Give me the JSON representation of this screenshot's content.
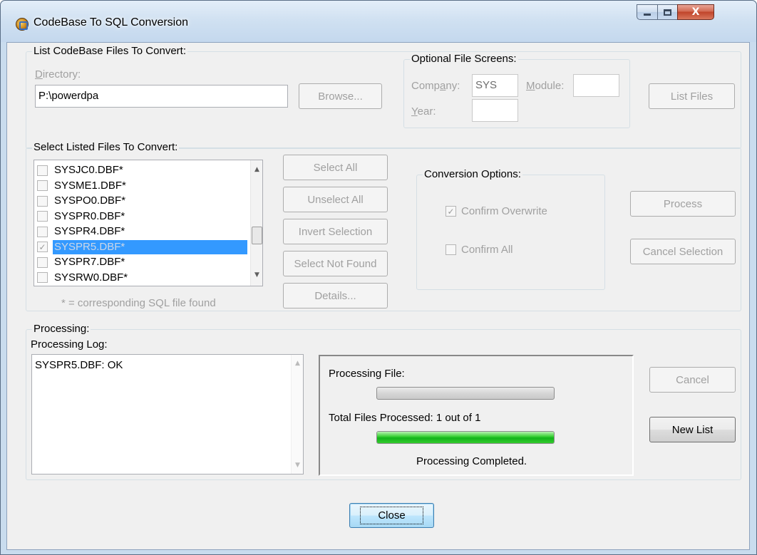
{
  "window": {
    "title": "CodeBase To SQL Conversion",
    "close_glyph": "X"
  },
  "list_group": {
    "label": "List CodeBase Files To Convert:",
    "directory_label": "Directory:",
    "directory_value": "P:\\powerdpa",
    "browse_button": "Browse...",
    "list_files_button": "List Files"
  },
  "screens_group": {
    "label": "Optional File Screens:",
    "company_label": "Company:",
    "company_value": "SYS",
    "module_label": "Module:",
    "module_value": "",
    "year_label": "Year:",
    "year_value": ""
  },
  "select_group": {
    "label": "Select Listed Files To Convert:",
    "files": [
      {
        "name": "SYSJC0.DBF*",
        "checked": false,
        "selected": false
      },
      {
        "name": "SYSME1.DBF*",
        "checked": false,
        "selected": false
      },
      {
        "name": "SYSPO0.DBF*",
        "checked": false,
        "selected": false
      },
      {
        "name": "SYSPR0.DBF*",
        "checked": false,
        "selected": false
      },
      {
        "name": "SYSPR4.DBF*",
        "checked": false,
        "selected": false
      },
      {
        "name": "SYSPR5.DBF*",
        "checked": true,
        "selected": true
      },
      {
        "name": "SYSPR7.DBF*",
        "checked": false,
        "selected": false
      },
      {
        "name": "SYSRW0.DBF*",
        "checked": false,
        "selected": false
      }
    ],
    "footnote": "* = corresponding SQL file found",
    "select_all": "Select All",
    "unselect_all": "Unselect All",
    "invert_selection": "Invert Selection",
    "select_not_found": "Select Not Found",
    "details": "Details...",
    "process": "Process",
    "cancel_selection": "Cancel Selection"
  },
  "conversion_options": {
    "label": "Conversion Options:",
    "confirm_overwrite": "Confirm Overwrite",
    "confirm_overwrite_checked": true,
    "confirm_all": "Confirm All",
    "confirm_all_checked": false
  },
  "processing_group": {
    "label": "Processing:",
    "log_label": "Processing Log:",
    "log_lines": [
      "SYSPR5.DBF: OK"
    ],
    "processing_file_label": "Processing File:",
    "processing_file_progress": 0,
    "total_label": "Total Files Processed: 1 out of 1",
    "total_progress": 1.0,
    "status": "Processing Completed.",
    "cancel_button": "Cancel",
    "new_list_button": "New List"
  },
  "close_button": "Close",
  "icons": {
    "app": "database-app-icon",
    "check": "✓",
    "scroll_up": "▲",
    "scroll_down": "▼"
  }
}
